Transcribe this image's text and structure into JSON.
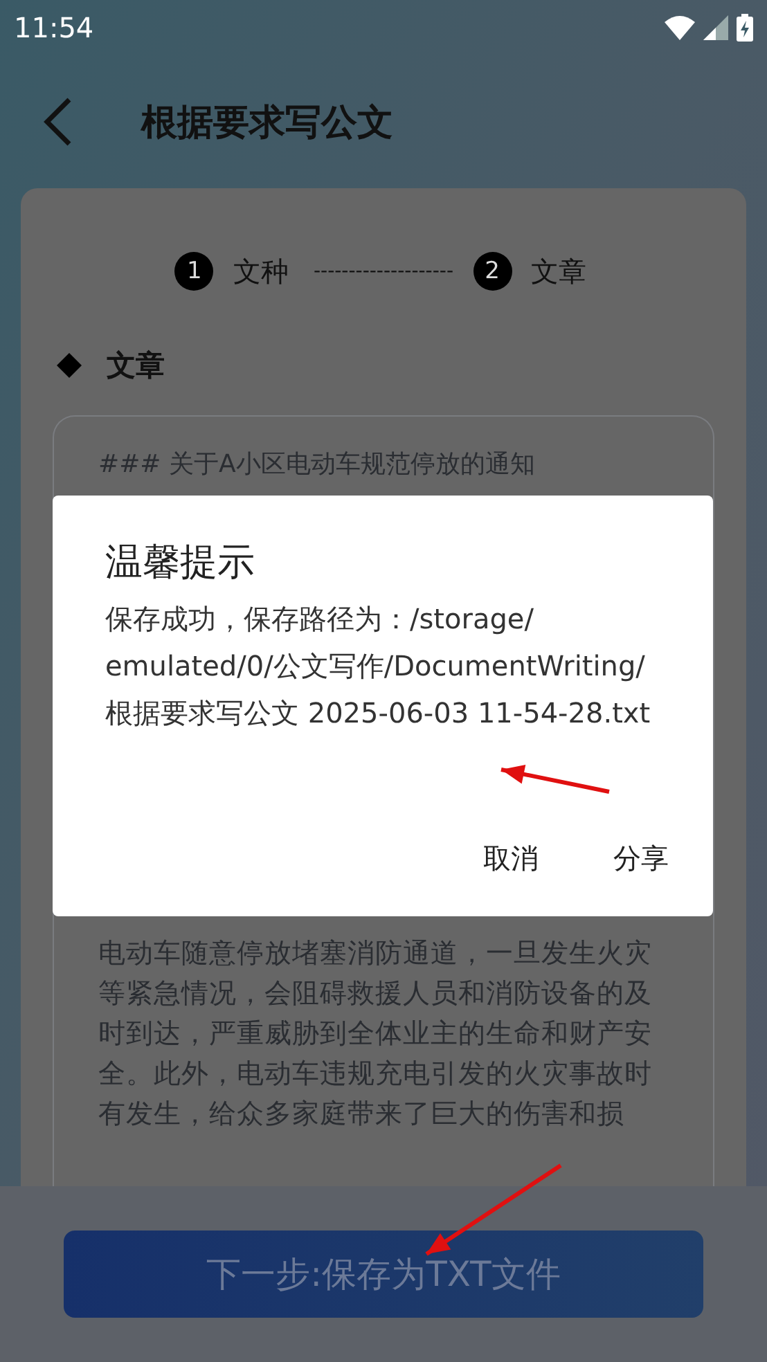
{
  "status_bar": {
    "time": "11:54"
  },
  "header": {
    "title": "根据要求写公文"
  },
  "stepper": {
    "steps": [
      {
        "number": "1",
        "label": "文种"
      },
      {
        "number": "2",
        "label": "文章"
      }
    ],
    "connector": "--------------------"
  },
  "section": {
    "title": "文章"
  },
  "article": {
    "heading": "### 关于A小区电动车规范停放的通知",
    "paragraphs": [
      "电动车随意停放堵塞消防通道，一旦发生火灾等紧急情况，会阻碍救援人员和消防设备的及时到达，严重威胁到全体业主的生命和财产安全。此外，电动车违规充电引发的火灾事故时有发生，给众多家庭带来了巨大的伤害和损"
    ]
  },
  "dialog": {
    "title": "温馨提示",
    "message": "保存成功，保存路径为：/storage/emulated/0/公文写作/DocumentWriting/根据要求写公文 2025-06-03 11-54-28.txt",
    "buttons": [
      "取消",
      "分享"
    ]
  },
  "primary_button": {
    "label": "下一步:保存为TXT文件"
  }
}
